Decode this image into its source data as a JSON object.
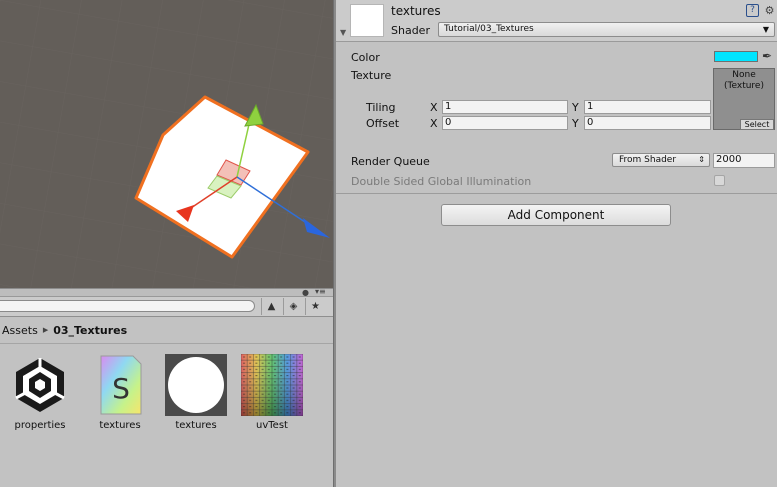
{
  "project": {
    "breadcrumb": [
      "Assets",
      "03_Textures"
    ],
    "assets": [
      {
        "label": "properties",
        "icon": "unity-logo-icon"
      },
      {
        "label": "textures",
        "icon": "shader-file-icon"
      },
      {
        "label": "textures",
        "icon": "material-sphere-icon"
      },
      {
        "label": "uvTest",
        "icon": "uv-texture-icon"
      }
    ]
  },
  "inspector": {
    "material_name": "textures",
    "shader_label": "Shader",
    "shader_value": "Tutorial/03_Textures",
    "props": {
      "color_label": "Color",
      "color_value": "#00e5ff",
      "texture_label": "Texture",
      "texture_slot_line1": "None",
      "texture_slot_line2": "(Texture)",
      "texture_select": "Select",
      "tiling_label": "Tiling",
      "offset_label": "Offset",
      "x_label": "X",
      "y_label": "Y",
      "tiling_x": "1",
      "tiling_y": "1",
      "offset_x": "0",
      "offset_y": "0",
      "render_queue_label": "Render Queue",
      "render_queue_mode": "From Shader",
      "render_queue_value": "2000",
      "dsgi_label": "Double Sided Global Illumination"
    },
    "add_component": "Add Component"
  }
}
